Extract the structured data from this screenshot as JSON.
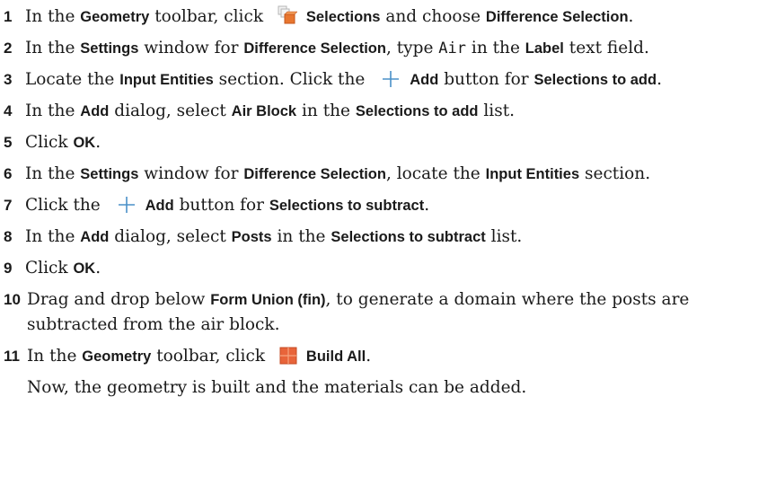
{
  "steps": [
    {
      "num": "1",
      "parts": [
        "In the ",
        "Geometry",
        " toolbar, click ",
        "Selections",
        " and choose ",
        "Difference Selection",
        "."
      ]
    },
    {
      "num": "2",
      "parts": [
        "In the ",
        "Settings",
        " window for ",
        "Difference Selection",
        ", type ",
        "Air",
        " in the ",
        "Label",
        " text field."
      ]
    },
    {
      "num": "3",
      "parts": [
        "Locate the ",
        "Input Entities",
        " section. Click the ",
        "Add",
        " button for ",
        "Selections to add",
        "."
      ]
    },
    {
      "num": "4",
      "parts": [
        "In the ",
        "Add",
        " dialog, select ",
        "Air Block",
        " in the ",
        "Selections to add",
        " list."
      ]
    },
    {
      "num": "5",
      "parts": [
        "Click ",
        "OK",
        "."
      ]
    },
    {
      "num": "6",
      "parts": [
        "In the ",
        "Settings",
        " window for ",
        "Difference Selection",
        ", locate the ",
        "Input Entities",
        " section."
      ]
    },
    {
      "num": "7",
      "parts": [
        "Click the ",
        "Add",
        " button for ",
        "Selections to subtract",
        "."
      ]
    },
    {
      "num": "8",
      "parts": [
        "In the ",
        "Add",
        " dialog, select ",
        "Posts",
        " in the ",
        "Selections to subtract",
        " list."
      ]
    },
    {
      "num": "9",
      "parts": [
        "Click ",
        "OK",
        "."
      ]
    },
    {
      "num": "10",
      "parts": [
        "Drag and drop below ",
        "Form Union (fin)",
        ", to generate a domain where the posts are"
      ],
      "cont": "subtracted from the air block."
    },
    {
      "num": "11",
      "parts": [
        "In the ",
        "Geometry",
        " toolbar, click ",
        "Build All",
        "."
      ]
    }
  ],
  "closing_note": "Now, the geometry is built and the materials can be added.",
  "icons": {
    "selections": "difference-selection-icon",
    "add": "plus-icon",
    "build_all": "build-all-icon"
  },
  "colors": {
    "text": "#1a1a1a",
    "plus": "#4a90c8",
    "build_all": "#e8643a",
    "selection_orange": "#e8762f"
  }
}
